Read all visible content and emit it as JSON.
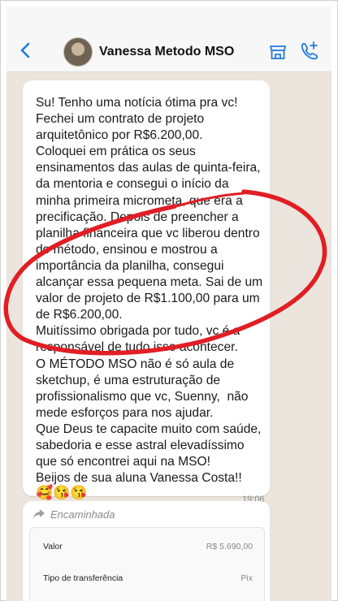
{
  "header": {
    "contact_name": "Vanessa Metodo MSO"
  },
  "message": {
    "text": "Su! Tenho uma notícia ótima pra vc!\nFechei um contrato de projeto\narquitetônico por R$6.200,00.\nColoquei em prática os seus\nensinamentos das aulas de quinta-feira,\nda mentoria e consegui o início da\nminha primeira micrometa, que era a\nprecificação. Depois de preencher a\nplanilha financeira que vc liberou dentro\ndo método, ensinou e mostrou a\nimportância da planilha, consegui\nalcançar essa pequena meta. Sai de um\nvalor de projeto de R$1.100,00 para um\nde R$6.200,00.\nMuitíssimo obrigada por tudo, vc é a\nresponsável de tudo isso acontecer.\nO MÉTODO MSO não é só aula de\nsketchup, é uma estruturação de\nprofissionalismo que vc, Suenny,  não\nmede esforços para nos ajudar.\nQue Deus te capacite muito com saúde,\nsabedoria e esse astral elevadíssimo\nque só encontrei aqui na MSO!\nBeijos de sua aluna Vanessa Costa!!",
    "emojis": "🥰😘😘",
    "time": "19:06"
  },
  "forwarded": {
    "label": "Encaminhada",
    "rows": [
      {
        "label": "Valor",
        "value": "R$ 5.690,00"
      },
      {
        "label": "Tipo de transferência",
        "value": "Pix"
      }
    ]
  },
  "colors": {
    "accent_blue": "#1f7ae0",
    "highlight_red": "#e21e25"
  }
}
